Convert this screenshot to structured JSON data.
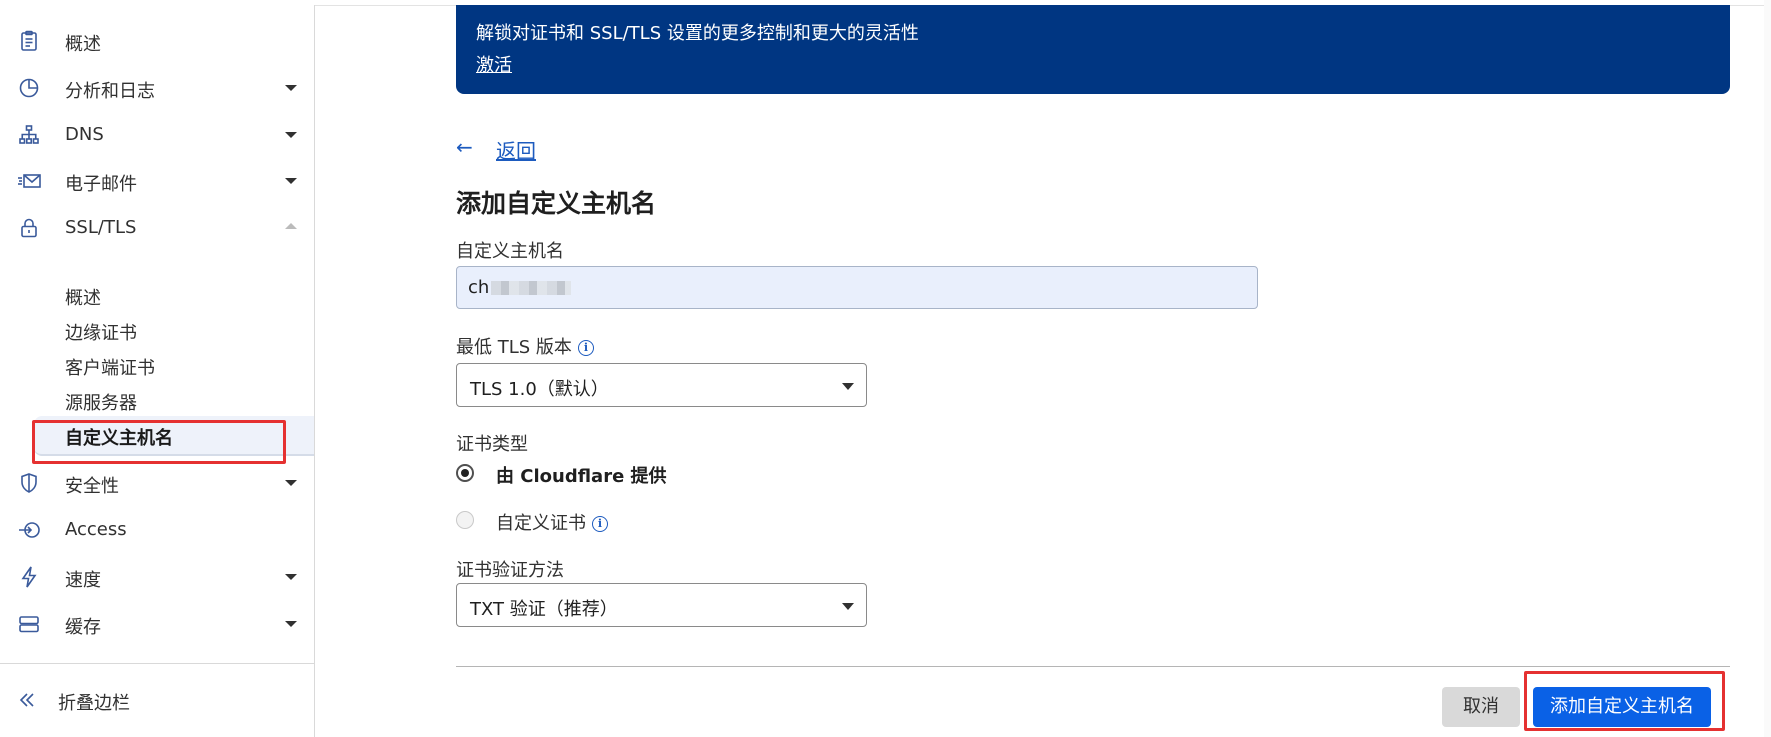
{
  "sidebar": {
    "items": [
      {
        "label": "概述",
        "icon": "clipboard-icon",
        "caret": "none"
      },
      {
        "label": "分析和日志",
        "icon": "pie-chart-icon",
        "caret": "down"
      },
      {
        "label": "DNS",
        "icon": "network-icon",
        "caret": "down"
      },
      {
        "label": "电子邮件",
        "icon": "mail-icon",
        "caret": "down"
      },
      {
        "label": "SSL/TLS",
        "icon": "lock-icon",
        "caret": "up"
      },
      {
        "label": "安全性",
        "icon": "shield-icon",
        "caret": "down"
      },
      {
        "label": "Access",
        "icon": "access-icon",
        "caret": "none"
      },
      {
        "label": "速度",
        "icon": "lightning-icon",
        "caret": "down"
      },
      {
        "label": "缓存",
        "icon": "storage-icon",
        "caret": "down"
      }
    ],
    "ssl_sub_items": [
      "概述",
      "边缘证书",
      "客户端证书",
      "源服务器",
      "自定义主机名"
    ],
    "active_sub_item": "自定义主机名",
    "collapse_label": "折叠边栏"
  },
  "banner": {
    "description": "解锁对证书和 SSL/TLS 设置的更多控制和更大的灵活性",
    "link": "激活"
  },
  "back_label": "返回",
  "page_title": "添加自定义主机名",
  "form": {
    "hostname_label": "自定义主机名",
    "hostname_value": "ch",
    "tls_label": "最低 TLS 版本",
    "tls_value": "TLS 1.0（默认）",
    "cert_type_label": "证书类型",
    "cert_options": [
      {
        "label": "由 Cloudflare 提供",
        "checked": true
      },
      {
        "label": "自定义证书",
        "checked": false
      }
    ],
    "validation_label": "证书验证方法",
    "validation_value": "TXT 验证（推荐）"
  },
  "actions": {
    "cancel": "取消",
    "submit": "添加自定义主机名"
  },
  "colors": {
    "banner_bg": "#003682",
    "primary": "#0a61e6",
    "link": "#1d5bbf",
    "highlight_box": "#e53131"
  }
}
